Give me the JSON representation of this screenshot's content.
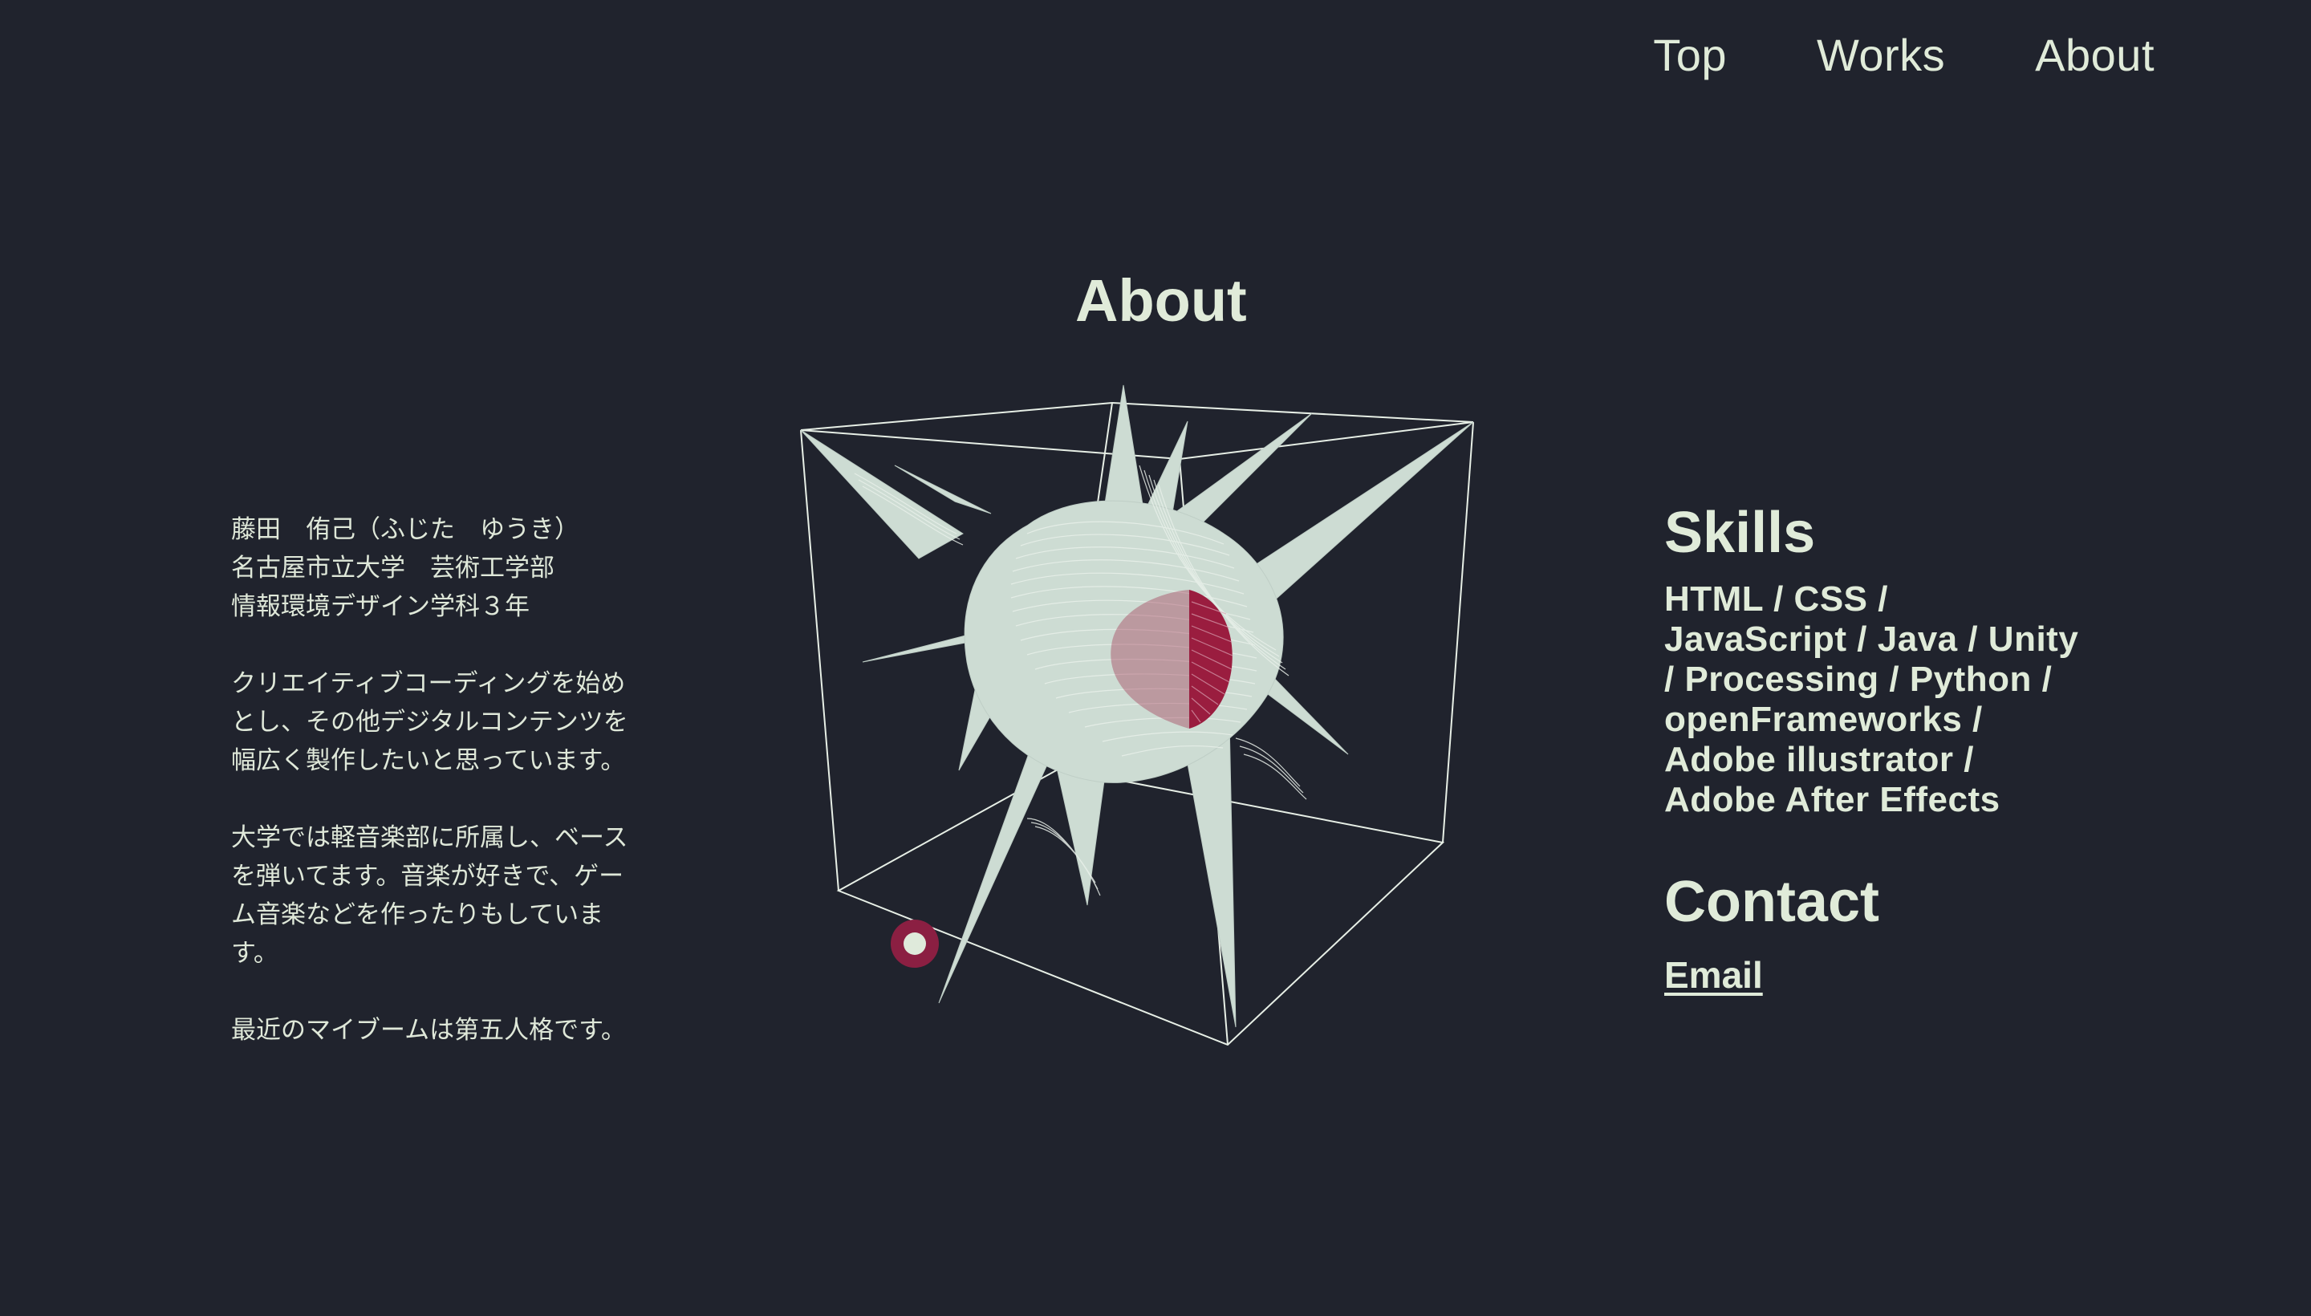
{
  "nav": {
    "items": [
      {
        "label": "Top"
      },
      {
        "label": "Works"
      },
      {
        "label": "About"
      }
    ]
  },
  "page_title": "About",
  "bio": {
    "profile_lines": [
      "藤田　侑己（ふじた　ゆうき）",
      "名古屋市立大学　芸術工学部",
      "情報環境デザイン学科３年"
    ],
    "intro_lines": [
      "クリエイティブコーディングを始め",
      "とし、その他デジタルコンテンツを",
      "幅広く製作したいと思っています。"
    ],
    "hobby_lines": [
      "大学では軽音楽部に所属し、ベース",
      "を弾いてます。音楽が好きで、ゲー",
      "ム音楽などを作ったりもしていま",
      "す。"
    ],
    "boom_line": "最近のマイブームは第五人格です。"
  },
  "skills": {
    "heading": "Skills",
    "lines": [
      "HTML / CSS /",
      "JavaScript / Java / Unity",
      "/ Processing / Python /",
      "openFrameworks /",
      "Adobe illustrator /",
      "Adobe After Effects"
    ]
  },
  "contact": {
    "heading": "Contact",
    "email_label": "Email"
  },
  "colors": {
    "background": "#20232d",
    "text": "#e0ebd9",
    "accent": "#8b1f42",
    "shape": "#ccdcd3"
  },
  "icons": {
    "orbit_marker": "circle-dot-icon"
  }
}
